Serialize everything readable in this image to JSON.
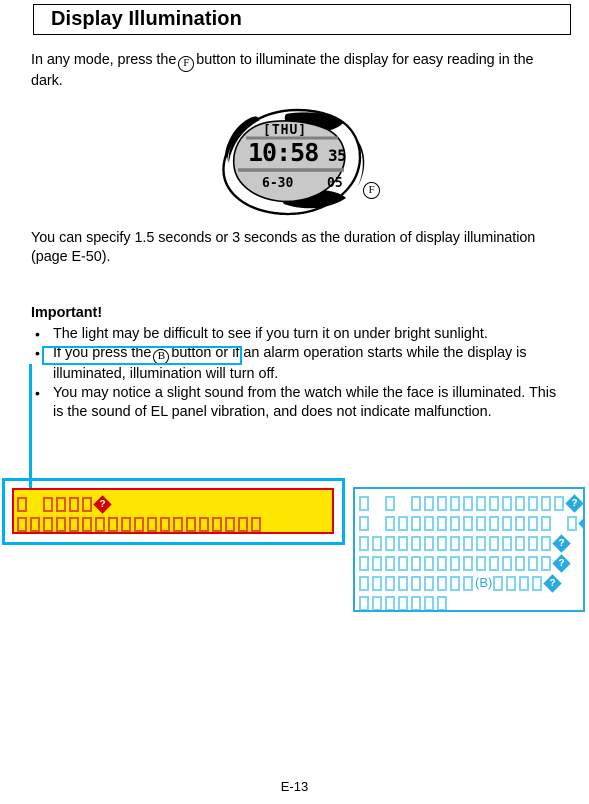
{
  "document": {
    "title": "Display Illumination",
    "footer_page": "E-13"
  },
  "body": {
    "para1_before": "In any mode, press the",
    "para1_button": "F",
    "para1_after": "button to illuminate the display for easy reading in the dark.",
    "para2": "You can specify 1.5 seconds or 3 seconds as the duration of display illumination (page E-50)."
  },
  "watch": {
    "day": "[THU]",
    "time": "10:58",
    "seconds": "35",
    "date": "6-30",
    "aux": "05",
    "button_marker": "F"
  },
  "important": {
    "heading": "Important!",
    "bullets": [
      {
        "text": "The light may be difficult to see if you turn it on under bright sunlight."
      },
      {
        "highlight_before": "If you press the",
        "highlight_button": "B",
        "highlight_after": "button",
        "text_rest": "or if an alarm operation starts while the display is illuminated, illumination will turn off."
      },
      {
        "text": "You may notice a slight sound from the watch while the face is illuminated. This is the sound of EL panel vibration, and does not indicate malfunction."
      }
    ]
  },
  "annotations": {
    "yellow_note": {
      "border_color": "#e00000",
      "fill_color": "#ffe600",
      "outer_border_color": "#00b0f0",
      "glyph_color": "#e8530e",
      "rows": [
        {
          "tofu_counts": [
            1,
            4
          ],
          "trailing_replacement": true
        },
        {
          "tofu_counts": [
            19
          ],
          "trailing_replacement": false
        }
      ]
    },
    "cyan_note": {
      "border_color": "#29abe2",
      "glyph_color": "#7fd4f2",
      "visible_text": "(B)",
      "rows": [
        {
          "tofu_counts": [
            1,
            1,
            12
          ],
          "trailing_replacement": true
        },
        {
          "tofu_counts": [
            1,
            13,
            1
          ],
          "trailing_replacement": true
        },
        {
          "tofu_counts": [
            15
          ],
          "trailing_replacement": true
        },
        {
          "tofu_counts": [
            15
          ],
          "trailing_replacement": true
        },
        {
          "tofu_counts": [
            9
          ],
          "inline_text": "(B)",
          "tofu_after": 4,
          "trailing_replacement": true
        },
        {
          "tofu_counts": [
            7
          ],
          "trailing_replacement": false
        }
      ]
    },
    "connector_color": "#00b0f0"
  }
}
